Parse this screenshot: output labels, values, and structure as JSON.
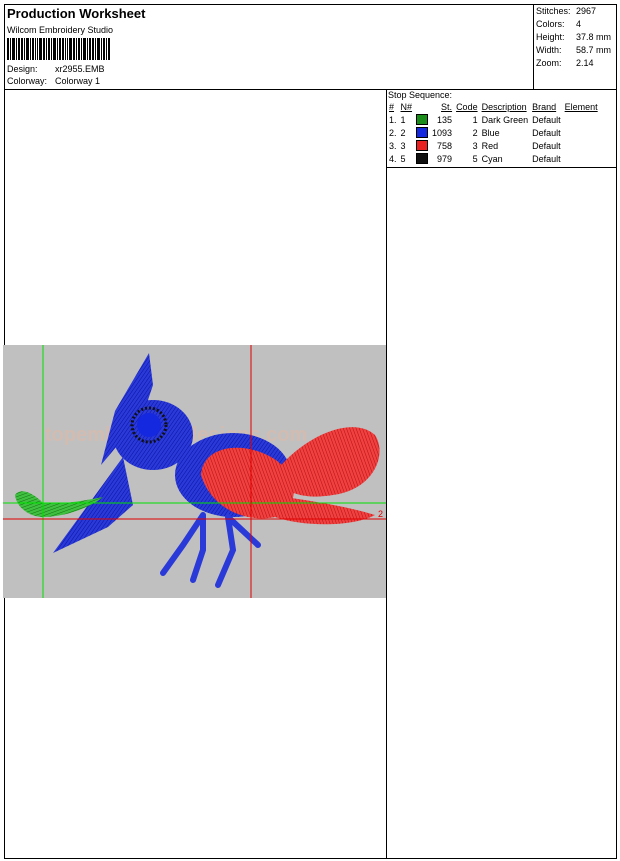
{
  "header": {
    "title": "Production Worksheet",
    "software": "Wilcom Embroidery Studio",
    "design_label": "Design:",
    "design_value": "xr2955.EMB",
    "colorway_label": "Colorway:",
    "colorway_value": "Colorway 1"
  },
  "stats": {
    "stitches_label": "Stitches:",
    "stitches_value": "2967",
    "colors_label": "Colors:",
    "colors_value": "4",
    "height_label": "Height:",
    "height_value": "37.8 mm",
    "width_label": "Width:",
    "width_value": "58.7 mm",
    "zoom_label": "Zoom:",
    "zoom_value": "2.14"
  },
  "stop_sequence": {
    "label": "Stop Sequence:",
    "headers": [
      "#",
      "N#",
      "St.",
      "Code",
      "Description",
      "Brand",
      "Element"
    ],
    "rows": [
      {
        "num": "1.",
        "n": "1",
        "color": "#1a8c1a",
        "st": "135",
        "code": "1",
        "description": "Dark Green",
        "brand": "Default",
        "element": ""
      },
      {
        "num": "2.",
        "n": "2",
        "color": "#1428e0",
        "st": "1093",
        "code": "2",
        "description": "Blue",
        "brand": "Default",
        "element": ""
      },
      {
        "num": "3.",
        "n": "3",
        "color": "#e82020",
        "st": "758",
        "code": "3",
        "description": "Red",
        "brand": "Default",
        "element": ""
      },
      {
        "num": "4.",
        "n": "5",
        "color": "#101010",
        "st": "979",
        "code": "5",
        "description": "Cyan",
        "brand": "Default",
        "element": ""
      }
    ]
  },
  "preview": {
    "marker_label": "2",
    "watermark": "topembroiderydesigns.com"
  },
  "colors": {
    "design_bg": "#c0c0c0",
    "guide_green": "#00e000",
    "guide_red": "#e00000"
  }
}
